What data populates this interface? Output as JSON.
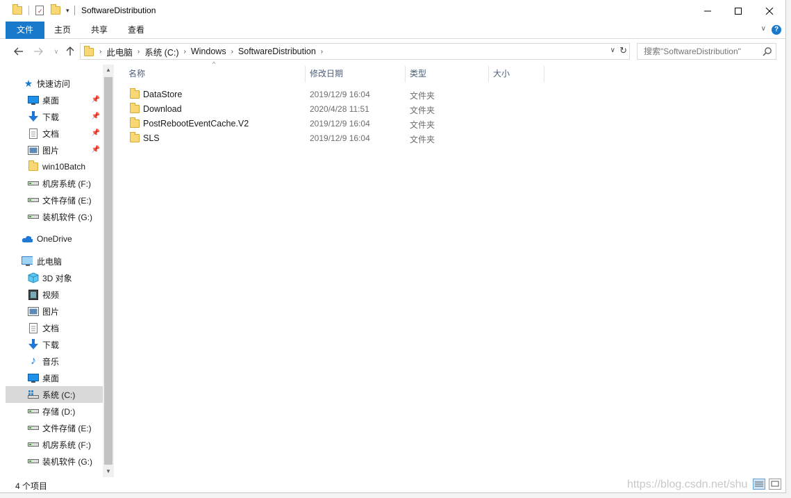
{
  "window": {
    "title": "SoftwareDistribution"
  },
  "ribbon": {
    "tabs": [
      "文件",
      "主页",
      "共享",
      "查看"
    ],
    "help": "?"
  },
  "address": {
    "crumbs": [
      "此电脑",
      "系统 (C:)",
      "Windows",
      "SoftwareDistribution"
    ]
  },
  "search": {
    "placeholder": "搜索\"SoftwareDistribution\""
  },
  "nav": {
    "quick_access": "快速访问",
    "quick_items": [
      "桌面",
      "下载",
      "文档",
      "图片",
      "win10Batch",
      "机房系统 (F:)",
      "文件存储 (E:)",
      "装机软件 (G:)"
    ],
    "onedrive": "OneDrive",
    "this_pc": "此电脑",
    "pc_items": [
      "3D 对象",
      "视频",
      "图片",
      "文档",
      "下载",
      "音乐",
      "桌面",
      "系统 (C:)",
      "存储 (D:)",
      "文件存储 (E:)",
      "机房系统 (F:)",
      "装机软件 (G:)"
    ]
  },
  "columns": {
    "name": "名称",
    "date": "修改日期",
    "type": "类型",
    "size": "大小"
  },
  "files": [
    {
      "name": "DataStore",
      "date": "2019/12/9 16:04",
      "type": "文件夹"
    },
    {
      "name": "Download",
      "date": "2020/4/28 11:51",
      "type": "文件夹"
    },
    {
      "name": "PostRebootEventCache.V2",
      "date": "2019/12/9 16:04",
      "type": "文件夹"
    },
    {
      "name": "SLS",
      "date": "2019/12/9 16:04",
      "type": "文件夹"
    }
  ],
  "status": {
    "count": "4 个项目",
    "watermark": "https://blog.csdn.net/shu"
  },
  "colors": {
    "accent": "#1979ca",
    "folder": "#f8d775",
    "selected": "#d9d9d9"
  }
}
